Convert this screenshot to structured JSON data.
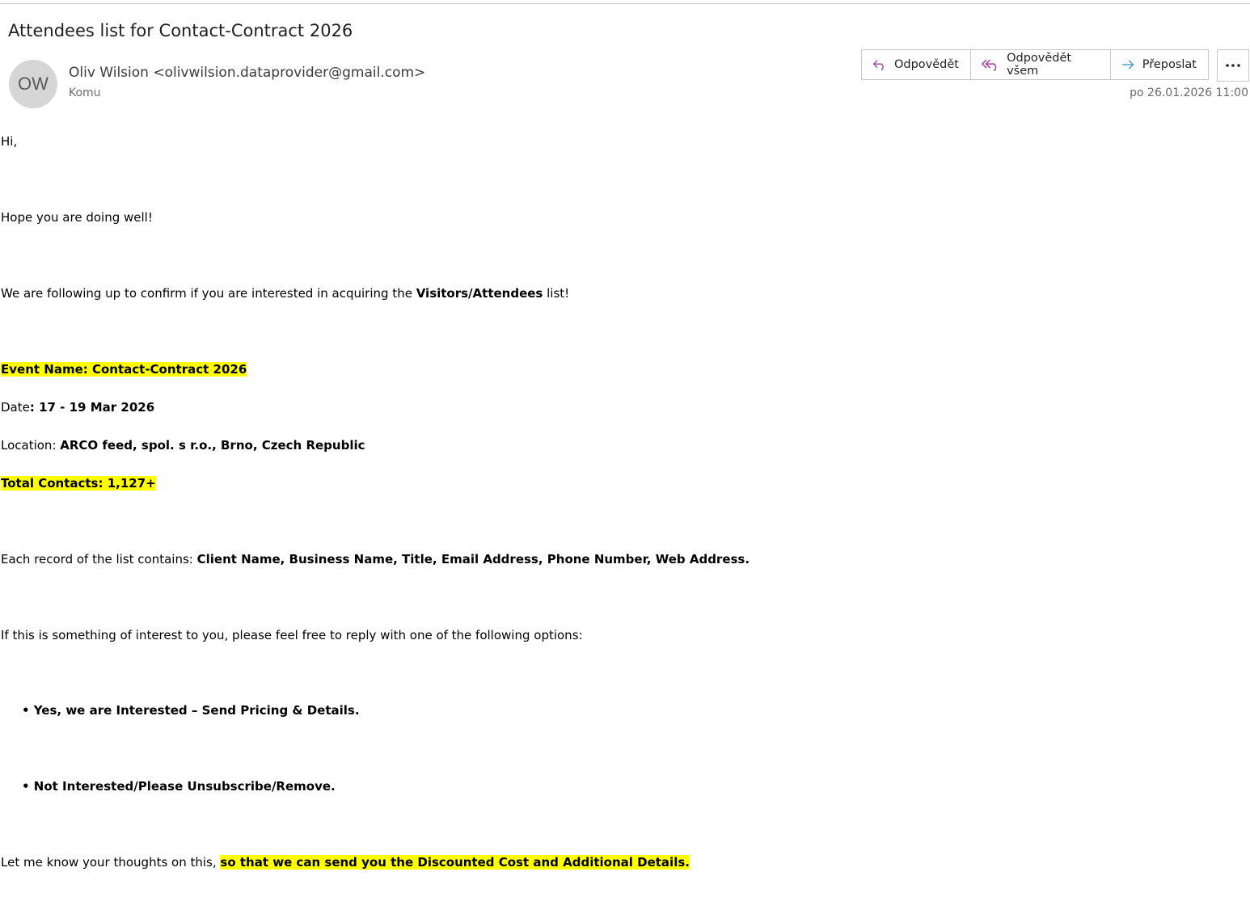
{
  "email": {
    "subject": "Attendees list for Contact-Contract 2026",
    "avatar_initials": "OW",
    "sender": "Oliv Wilsion <olivwilsion.dataprovider@gmail.com>",
    "to_label": "Komu",
    "date": "po 26.01.2026 11:00"
  },
  "actions": {
    "reply": "Odpovědět",
    "reply_all": "Odpovědět všem",
    "forward": "Přeposlat",
    "more_icon": "more-horizontal-icon"
  },
  "body": {
    "greeting": "Hi,",
    "line1": "Hope you are doing well!",
    "line2_prefix": "We are following up to confirm if you are interested in acquiring the ",
    "line2_bold": "Visitors/Attendees",
    "line2_suffix": " list!",
    "event_name": "Event Name: Contact-Contract 2026",
    "date_label": "Date",
    "date_value": ": 17 - 19 Mar 2026",
    "location_label": "Location: ",
    "location_value": "ARCO feed, spol. s r.o., Brno, Czech Republic",
    "total_contacts": "Total Contacts: 1,127+",
    "record_prefix": "Each record of the list contains: ",
    "record_fields": "Client Name, Business Name, Title, Email Address, Phone Number, Web Address.",
    "interest_line": "If this is something of interest to you, please feel free to reply with one of the following options:",
    "option1": "• Yes, we are Interested – Send Pricing & Details.",
    "option2": "• Not Interested/Please Unsubscribe/Remove.",
    "closing_prefix": "Let me know your thoughts on this, ",
    "closing_highlight": "so that we can send you the Discounted Cost and Additional Details."
  },
  "colors": {
    "highlight": "#ffff00",
    "reply_icon": "#a33ea0",
    "forward_icon": "#2a8fbd"
  }
}
